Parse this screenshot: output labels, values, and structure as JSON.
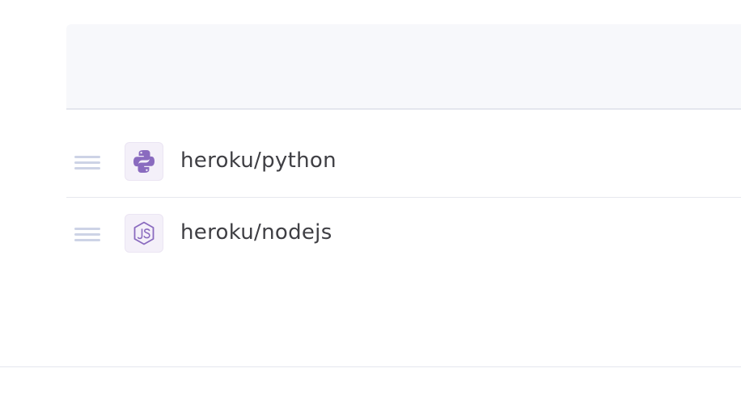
{
  "colors": {
    "header_bg": "#f7f8fb",
    "divider": "#e4e6ee",
    "handle": "#cdd3e6",
    "icon_bg": "#f4f0f9",
    "icon_fg": "#8a6bbf",
    "text": "#3f3f44"
  },
  "buildpacks": [
    {
      "name": "heroku/python",
      "icon": "python-icon"
    },
    {
      "name": "heroku/nodejs",
      "icon": "nodejs-icon"
    }
  ]
}
